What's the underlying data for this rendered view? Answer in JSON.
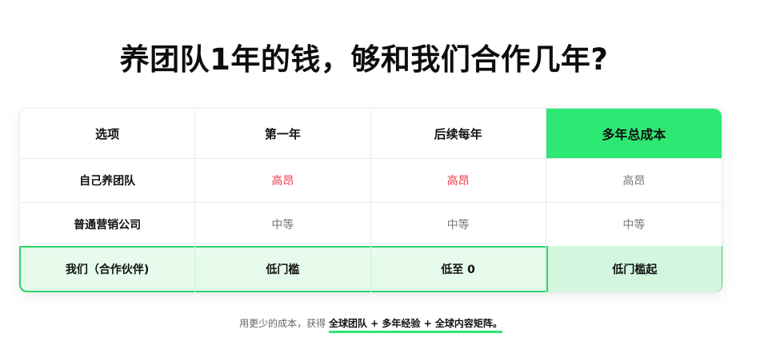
{
  "title": "养团队1年的钱，够和我们合作几年?",
  "table": {
    "headers": [
      "选项",
      "第一年",
      "后续每年",
      "多年总成本"
    ],
    "rows": [
      {
        "label": "自己养团队",
        "first_year": "高昂",
        "per_year": "高昂",
        "total": "高昂"
      },
      {
        "label": "普通营销公司",
        "first_year": "中等",
        "per_year": "中等",
        "total": "中等"
      },
      {
        "label": "我们（合作伙伴)",
        "first_year": "低门槛",
        "per_year": "低至 0",
        "total": "低门槛起"
      }
    ]
  },
  "footer": {
    "prefix": "用更少的成本，获得",
    "highlight": "全球团队 + 多年经验 + 全球内容矩阵。"
  },
  "colors": {
    "accent_green": "#2ee874",
    "highlight_row_bg": "#e6fbec",
    "expensive_red": "#e8424a"
  }
}
